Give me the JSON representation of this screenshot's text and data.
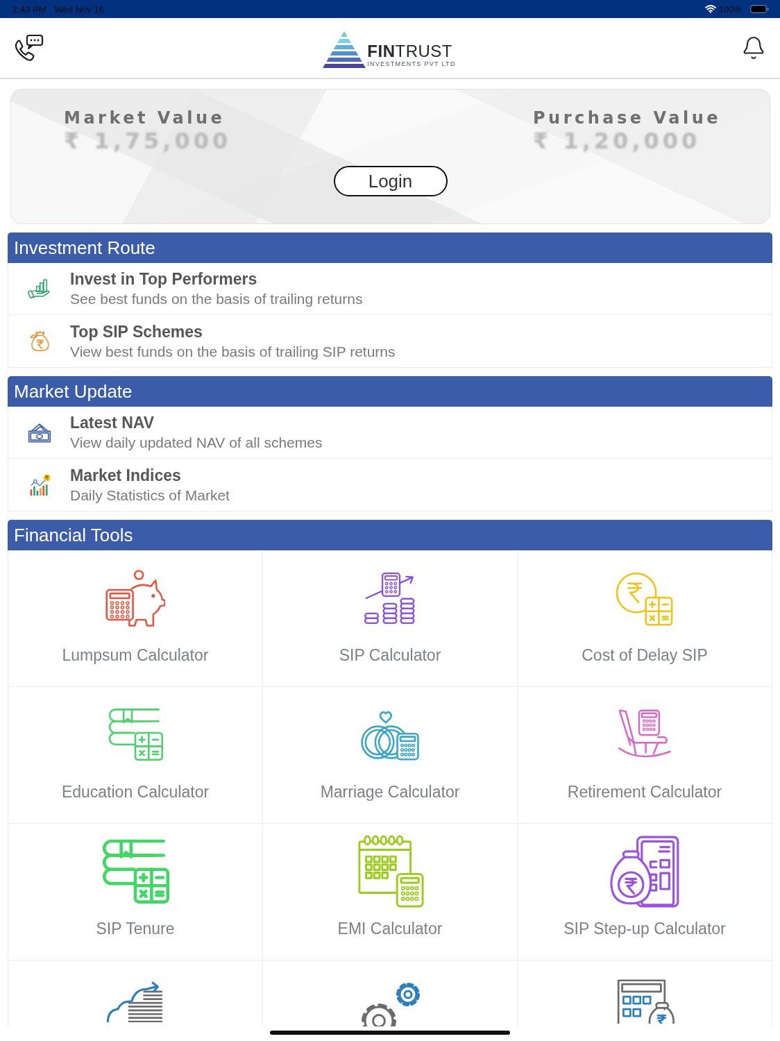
{
  "status_bar": {
    "time": "2:43 PM",
    "date": "Wed Nov 16",
    "battery": "100%"
  },
  "header": {
    "logo": {
      "wordmark": "**FIN**TRUST",
      "tagline": "INVESTMENTS PVT LTD"
    }
  },
  "portfolio_card": {
    "values": [
      {
        "label": "Market Value",
        "amount": "₹ 1,75,000"
      },
      {
        "label": "Purchase Value",
        "amount": "₹ 1,20,000"
      }
    ],
    "login_button": "Login"
  },
  "sections": [
    {
      "title": "Investment Route",
      "items": [
        {
          "title": "Invest in Top Performers",
          "subtitle": "See best funds on the basis of trailing returns"
        },
        {
          "title": "Top SIP Schemes",
          "subtitle": "View best funds on the basis of trailing SIP returns"
        }
      ]
    },
    {
      "title": "Market Update",
      "items": [
        {
          "title": "Latest NAV",
          "subtitle": "View daily updated NAV of all schemes"
        },
        {
          "title": "Market Indices",
          "subtitle": "Daily Statistics of Market"
        }
      ]
    }
  ],
  "financial_tools": {
    "title": "Financial Tools",
    "tools": [
      {
        "label": "Lumpsum Calculator"
      },
      {
        "label": "SIP Calculator"
      },
      {
        "label": "Cost of Delay SIP"
      },
      {
        "label": "Education Calculator"
      },
      {
        "label": "Marriage Calculator"
      },
      {
        "label": "Retirement Calculator"
      },
      {
        "label": "SIP Tenure"
      },
      {
        "label": "EMI Calculator"
      },
      {
        "label": "SIP Step-up Calculator"
      }
    ]
  }
}
